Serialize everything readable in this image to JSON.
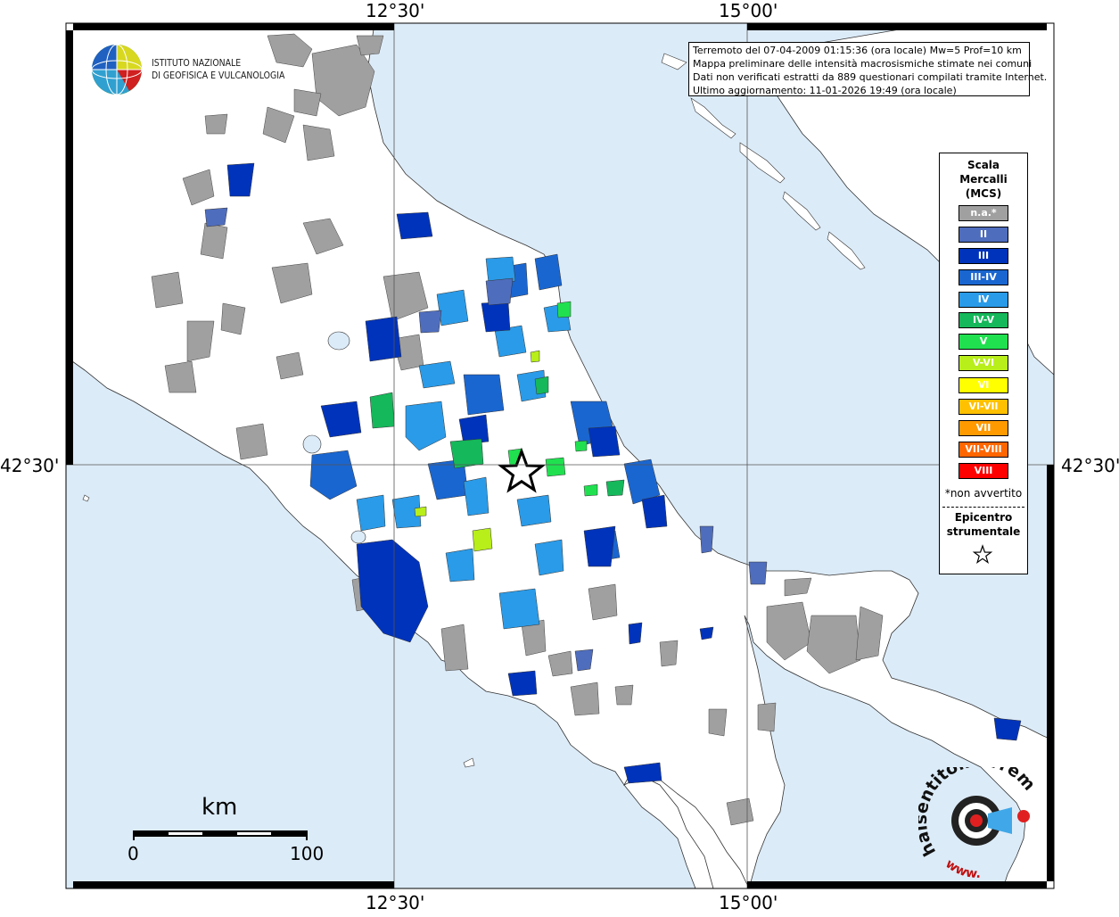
{
  "axes": {
    "top_left": "12°30'",
    "top_right": "15°00'",
    "bottom_left": "12°30'",
    "bottom_right": "15°00'",
    "left_lat": "42°30'",
    "right_lat": "42°30'"
  },
  "info": {
    "line1": "Terremoto del 07-04-2009 01:15:36 (ora locale) Mw=5 Prof=10 km",
    "line2": "Mappa preliminare delle intensità macrosismiche stimate nei comuni",
    "line3": "Dati non verificati estratti da 889 questionari compilati tramite Internet.",
    "line4": "Ultimo aggiornamento: 11-01-2026 19:49 (ora locale)"
  },
  "logo": {
    "line1": "ISTITUTO NAZIONALE",
    "line2": "DI GEOFISICA E VULCANOLOGIA"
  },
  "legend": {
    "title1": "Scala",
    "title2": "Mercalli",
    "title3": "(MCS)",
    "items": [
      {
        "label": "n.a.*",
        "color": "#a0a0a0"
      },
      {
        "label": "II",
        "color": "#4f6dbd"
      },
      {
        "label": "III",
        "color": "#0033bb"
      },
      {
        "label": "III-IV",
        "color": "#1a66d0"
      },
      {
        "label": "IV",
        "color": "#2a9be8"
      },
      {
        "label": "IV-V",
        "color": "#15b85a"
      },
      {
        "label": "V",
        "color": "#20e050"
      },
      {
        "label": "V-VI",
        "color": "#b8ee1a"
      },
      {
        "label": "VI",
        "color": "#ffff00"
      },
      {
        "label": "VI-VII",
        "color": "#ffc000"
      },
      {
        "label": "VII",
        "color": "#ff9a00"
      },
      {
        "label": "VII-VIII",
        "color": "#ff6600"
      },
      {
        "label": "VIII",
        "color": "#ff0000"
      }
    ],
    "note": "*non avvertito",
    "epi1": "Epicentro",
    "epi2": "strumentale"
  },
  "scale": {
    "title": "km",
    "min": "0",
    "max": "100"
  },
  "colors": {
    "sea": "#dcebf8",
    "land": "#ffffff",
    "na": "#a0a0a0",
    "border": "#000000"
  },
  "credit": {
    "site": "haisentitoilterremoto.it",
    "www": "www."
  }
}
